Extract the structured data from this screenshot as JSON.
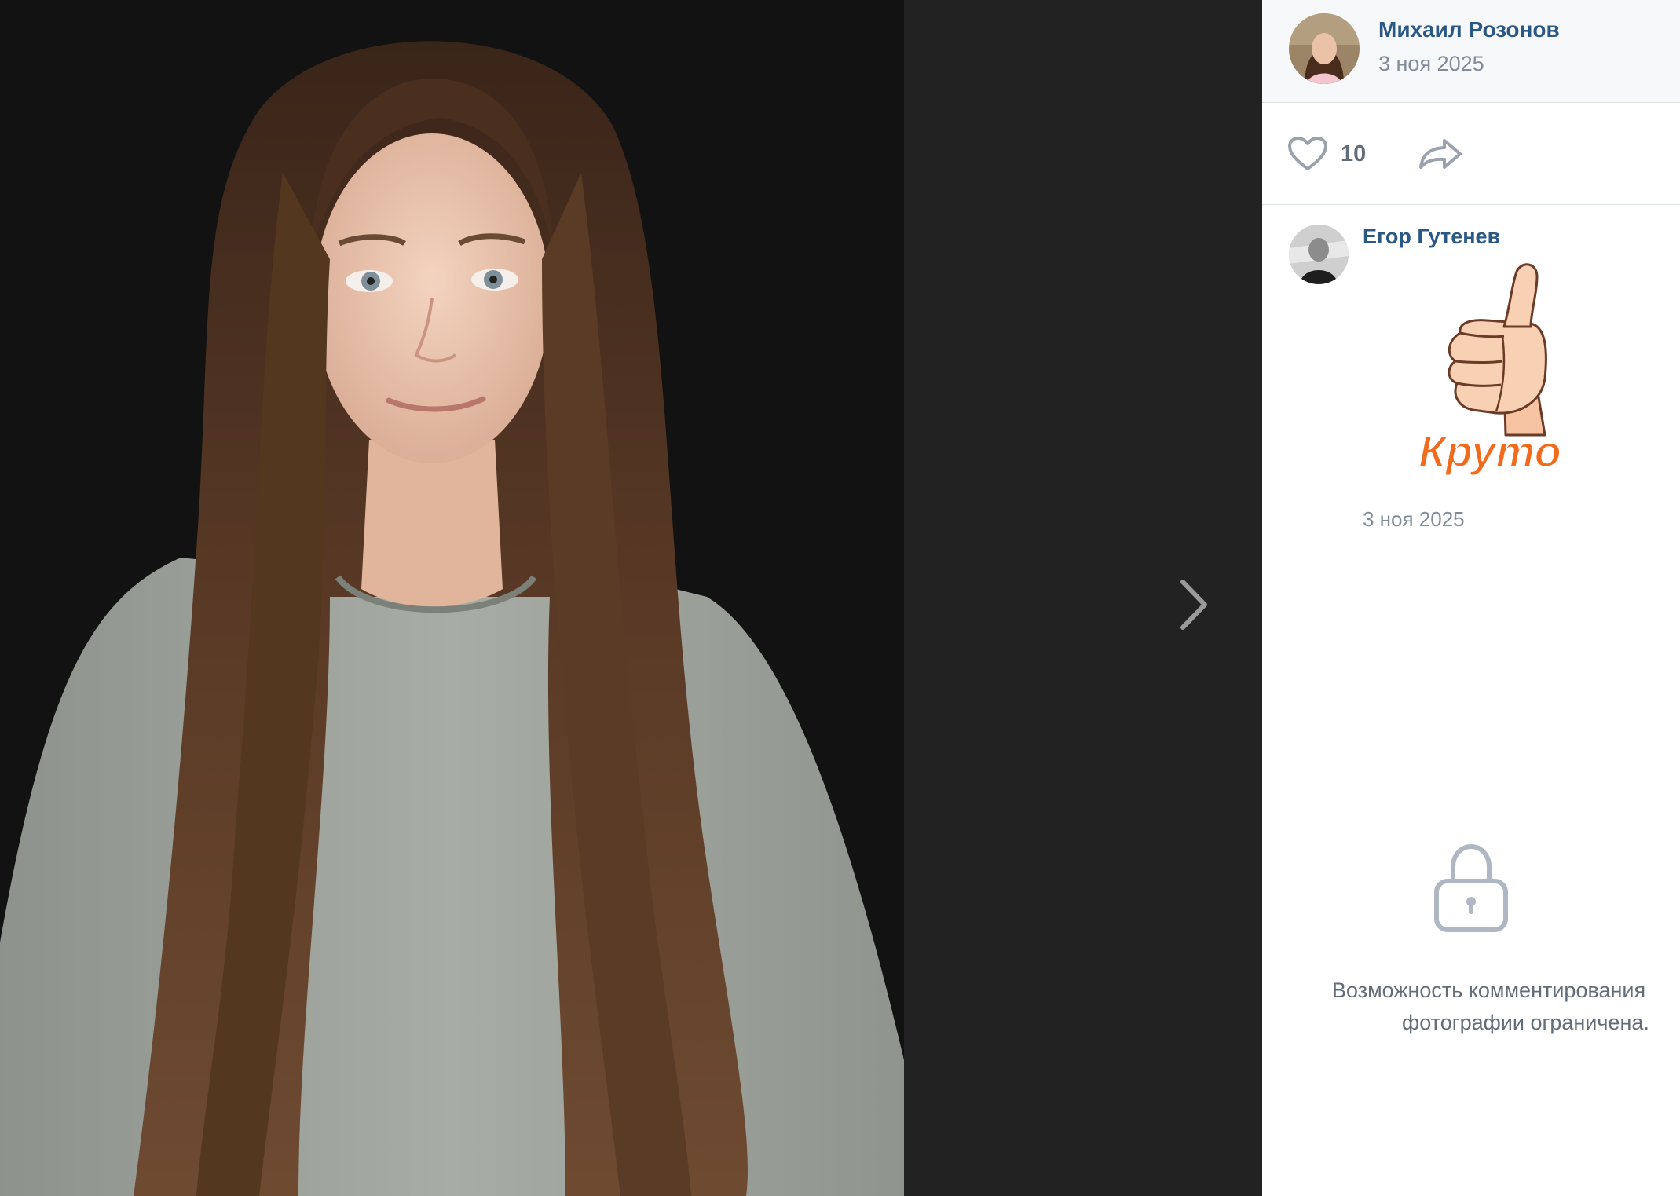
{
  "author": {
    "name": "Михаил Розонов",
    "date": "3 ноя 2025"
  },
  "actions": {
    "likes": "10"
  },
  "comment": {
    "name": "Егор Гутенев",
    "sticker_text": "Круто",
    "date": "3 ноя 2025"
  },
  "restriction": {
    "line1": "Возможность комментирования",
    "line2": "фотографии ограничена."
  },
  "icons": {
    "like": "heart-icon",
    "share": "share-arrow-icon",
    "next": "chevron-right-icon",
    "lock": "lock-icon"
  },
  "colors": {
    "link": "#2a5885",
    "muted": "#818c99",
    "viewer_bg": "#222222",
    "panel_bg": "#ffffff",
    "sticker_text": "#f26a1b"
  }
}
